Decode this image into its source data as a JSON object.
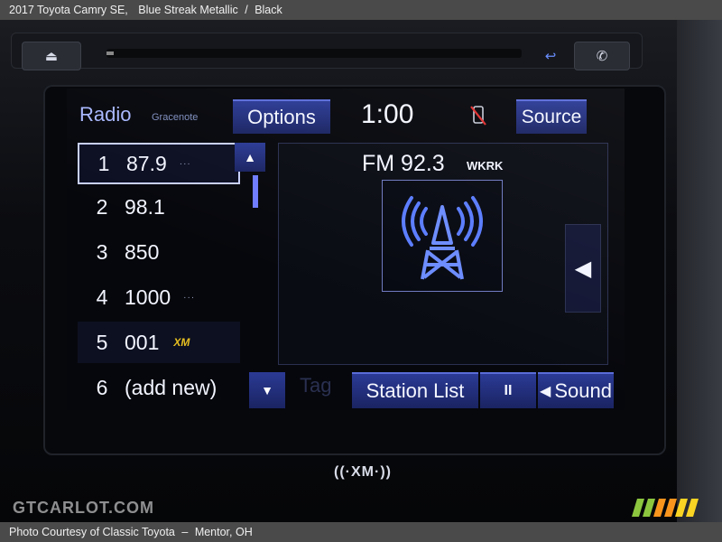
{
  "caption_top": {
    "model": "2017 Toyota Camry SE,",
    "color": "Blue Streak Metallic",
    "separator": "/",
    "interior": "Black"
  },
  "caption_bottom": {
    "credit": "Photo Courtesy of Classic Toyota",
    "separator": "–",
    "location": "Mentor, OH"
  },
  "watermark": "GTCARLOT.COM",
  "header": {
    "title": "Radio",
    "provider": "Gracenote",
    "options_label": "Options",
    "clock": "1:00",
    "source_label": "Source"
  },
  "presets": [
    {
      "num": "1",
      "value": "87.9",
      "extra": "···",
      "selected": true
    },
    {
      "num": "2",
      "value": "98.1",
      "extra": ""
    },
    {
      "num": "3",
      "value": "850",
      "extra": ""
    },
    {
      "num": "4",
      "value": "1000",
      "extra": "···"
    },
    {
      "num": "5",
      "value": "001",
      "extra": "XM"
    },
    {
      "num": "6",
      "value": "(add new)",
      "extra": ""
    }
  ],
  "now_playing": {
    "frequency": "FM 92.3",
    "call_sign": "WKRK",
    "art_icon": "radio-tower-icon"
  },
  "bottom": {
    "tag_label": "Tag",
    "station_list_label": "Station List",
    "pause_label": "II",
    "sound_label": "Sound"
  },
  "bezel_logo": "((·XM·))",
  "colors": {
    "accent": "#2b3a95",
    "highlight": "#a9b8ff",
    "xm_yellow": "#e8c020"
  }
}
